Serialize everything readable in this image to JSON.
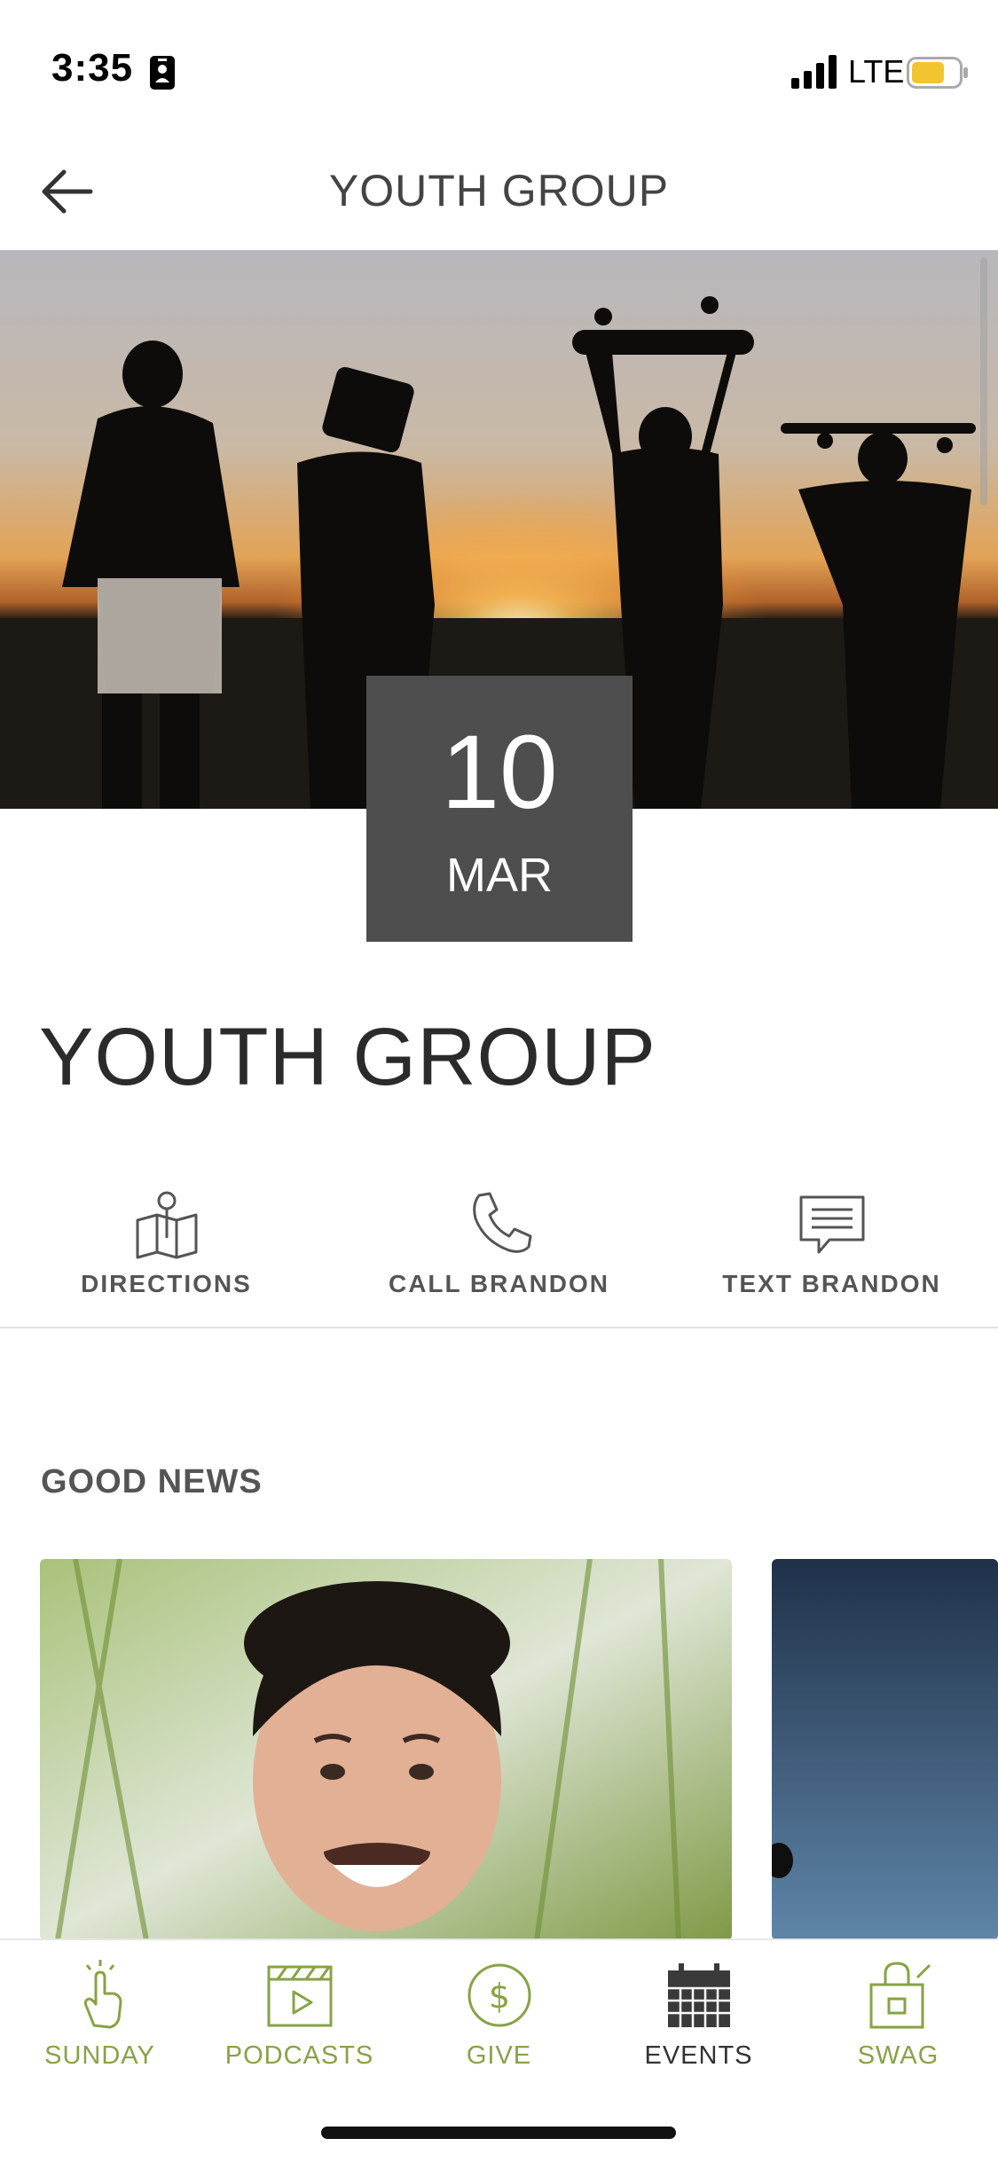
{
  "status_bar": {
    "time": "3:35",
    "network": "LTE"
  },
  "nav": {
    "title": "YOUTH GROUP",
    "back_icon": "arrow-left-icon"
  },
  "event": {
    "day": "10",
    "month": "MAR",
    "title": "YOUTH GROUP"
  },
  "actions": [
    {
      "label": "DIRECTIONS",
      "icon": "map-pin-icon"
    },
    {
      "label": "CALL BRANDON",
      "icon": "phone-icon"
    },
    {
      "label": "TEXT BRANDON",
      "icon": "message-icon"
    }
  ],
  "good_news": {
    "title": "GOOD NEWS"
  },
  "tabs": [
    {
      "label": "SUNDAY",
      "icon": "hand-tap-icon",
      "active": false
    },
    {
      "label": "PODCASTS",
      "icon": "video-clapper-icon",
      "active": false
    },
    {
      "label": "GIVE",
      "icon": "dollar-circle-icon",
      "active": false
    },
    {
      "label": "EVENTS",
      "icon": "calendar-icon",
      "active": true
    },
    {
      "label": "SWAG",
      "icon": "shopping-bag-icon",
      "active": false
    }
  ],
  "colors": {
    "accent": "#86a346",
    "date_badge": "#4e4e4e",
    "active_tab": "#333333"
  }
}
